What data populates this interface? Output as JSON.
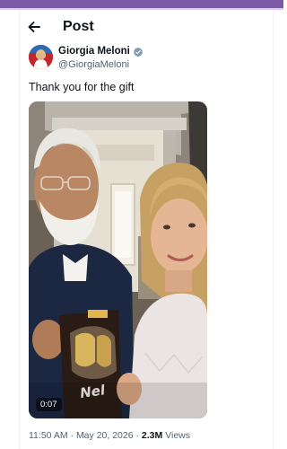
{
  "header": {
    "title": "Post"
  },
  "author": {
    "name": "Giorgia Meloni",
    "handle": "@GiorgiaMeloni",
    "verified": true
  },
  "post": {
    "text": "Thank you for the gift",
    "media": {
      "type": "video",
      "duration": "0:07"
    }
  },
  "meta": {
    "time": "11:50 AM",
    "separator": "·",
    "date": "May 20, 2026",
    "views_count": "2.3M",
    "views_label": "Views"
  },
  "colors": {
    "accent_strip": "#7b5aa6",
    "text_primary": "#0f1419",
    "text_secondary": "#536471",
    "verified_badge": "#829aab"
  },
  "icons": {
    "back": "back-arrow-icon",
    "verified": "verified-badge-icon"
  }
}
